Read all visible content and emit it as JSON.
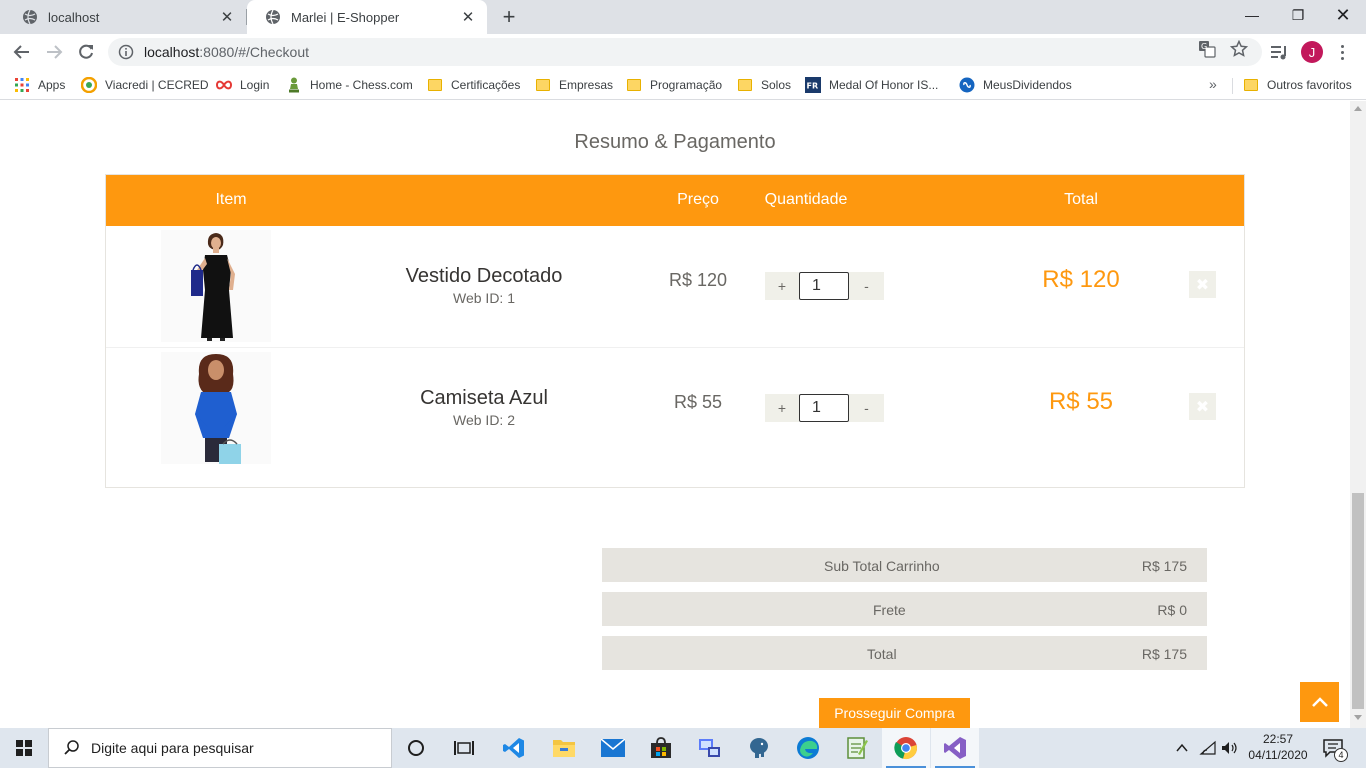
{
  "browser": {
    "tabs": [
      {
        "title": "localhost",
        "close": "✕",
        "active": false
      },
      {
        "title": "Marlei | E-Shopper",
        "close": "✕",
        "active": true
      }
    ],
    "new_tab": "+",
    "url_host": "localhost",
    "url_rest": ":8080/#/Checkout",
    "avatar_letter": "J",
    "window": {
      "minimize": "—",
      "maximize": "❐",
      "close": "✕"
    }
  },
  "bookmarks": {
    "items": [
      {
        "label": "Apps",
        "icon": "apps-grid-icon"
      },
      {
        "label": "Viacredi | CECRED",
        "icon": "viacredi-icon"
      },
      {
        "label": "Login",
        "icon": "infinity-icon"
      },
      {
        "label": "Home - Chess.com",
        "icon": "chess-pawn-icon"
      },
      {
        "label": "Certificações",
        "icon": "folder-icon"
      },
      {
        "label": "Empresas",
        "icon": "folder-icon"
      },
      {
        "label": "Programação",
        "icon": "folder-icon"
      },
      {
        "label": "Solos",
        "icon": "folder-icon"
      },
      {
        "label": "Medal Of Honor IS...",
        "icon": "fr-icon"
      },
      {
        "label": "MeusDividendos",
        "icon": "meusdividendos-icon"
      }
    ],
    "more": "»",
    "other": "Outros favoritos"
  },
  "page": {
    "section_title": "Resumo & Pagamento",
    "table_headers": {
      "item": "Item",
      "price": "Preço",
      "quantity": "Quantidade",
      "total": "Total"
    },
    "items": [
      {
        "name": "Vestido Decotado",
        "web_id": "Web ID: 1",
        "price": "R$ 120",
        "qty": "1",
        "total": "R$ 120",
        "plus": "+",
        "minus": "-",
        "delete": "✖"
      },
      {
        "name": "Camiseta Azul",
        "web_id": "Web ID: 2",
        "price": "R$ 55",
        "qty": "1",
        "total": "R$ 55",
        "plus": "+",
        "minus": "-",
        "delete": "✖"
      }
    ],
    "summary": [
      {
        "label": "Sub Total Carrinho",
        "value": "R$ 175"
      },
      {
        "label": "Frete",
        "value": "R$ 0"
      },
      {
        "label": "Total",
        "value": "R$ 175"
      }
    ],
    "proceed_label": "Prosseguir Compra",
    "accent_color": "#fe980f"
  },
  "taskbar": {
    "search_placeholder": "Digite aqui para pesquisar",
    "time": "22:57",
    "date": "04/11/2020",
    "notifications": "4"
  }
}
